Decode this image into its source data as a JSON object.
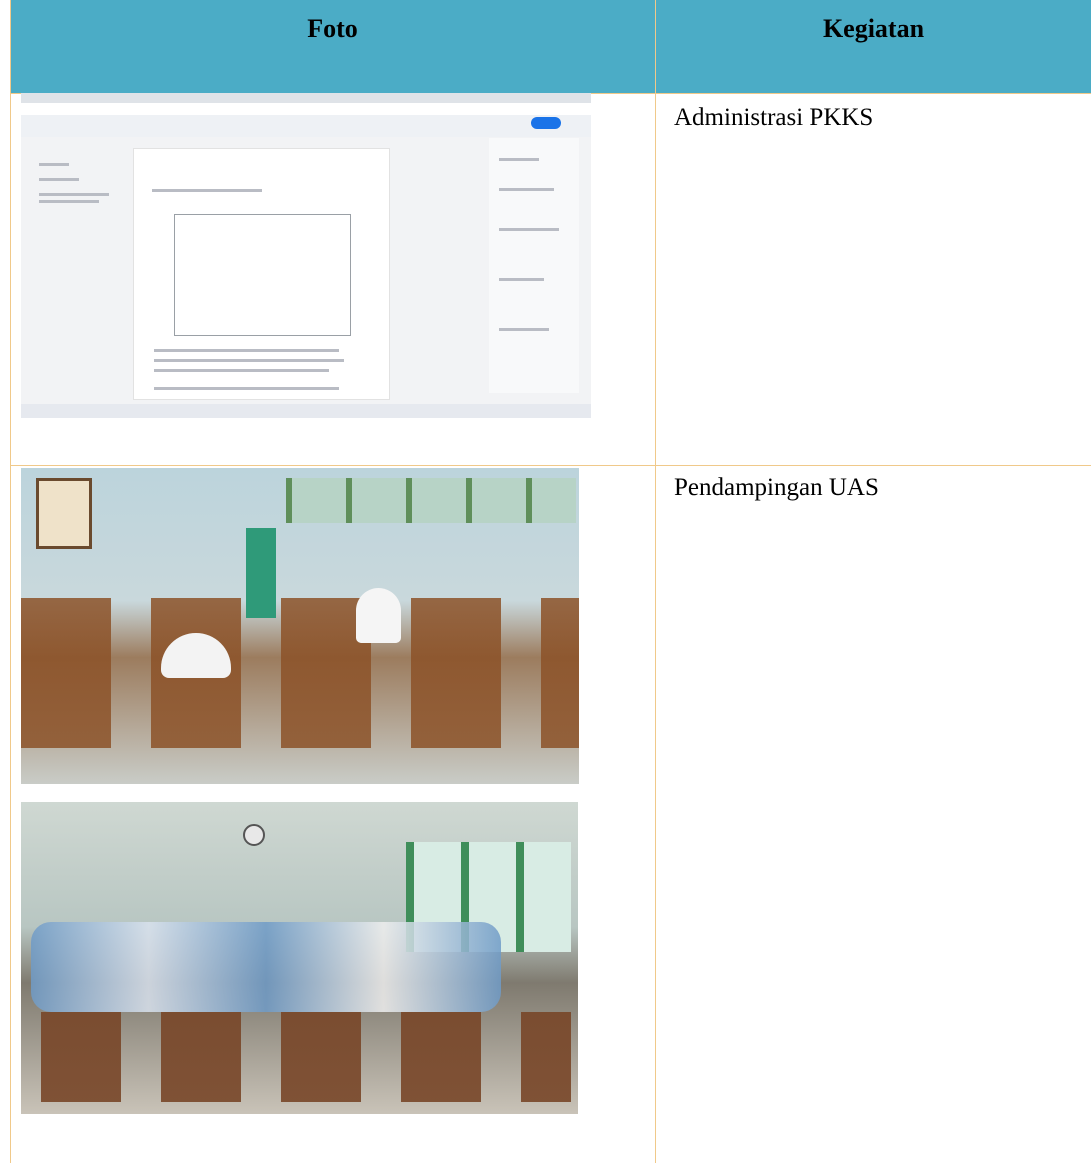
{
  "table": {
    "headers": [
      "Foto",
      "Kegiatan"
    ],
    "rows": [
      {
        "photos": [
          "screenshot-photo"
        ],
        "kegiatan": "Administrasi PKKS"
      },
      {
        "photos": [
          "classroom-photo",
          "classroom-photo"
        ],
        "kegiatan": "Pendampingan UAS"
      }
    ]
  },
  "colors": {
    "header_bg": "#4bacc6",
    "border": "#f0c98a",
    "text": "#000000"
  }
}
